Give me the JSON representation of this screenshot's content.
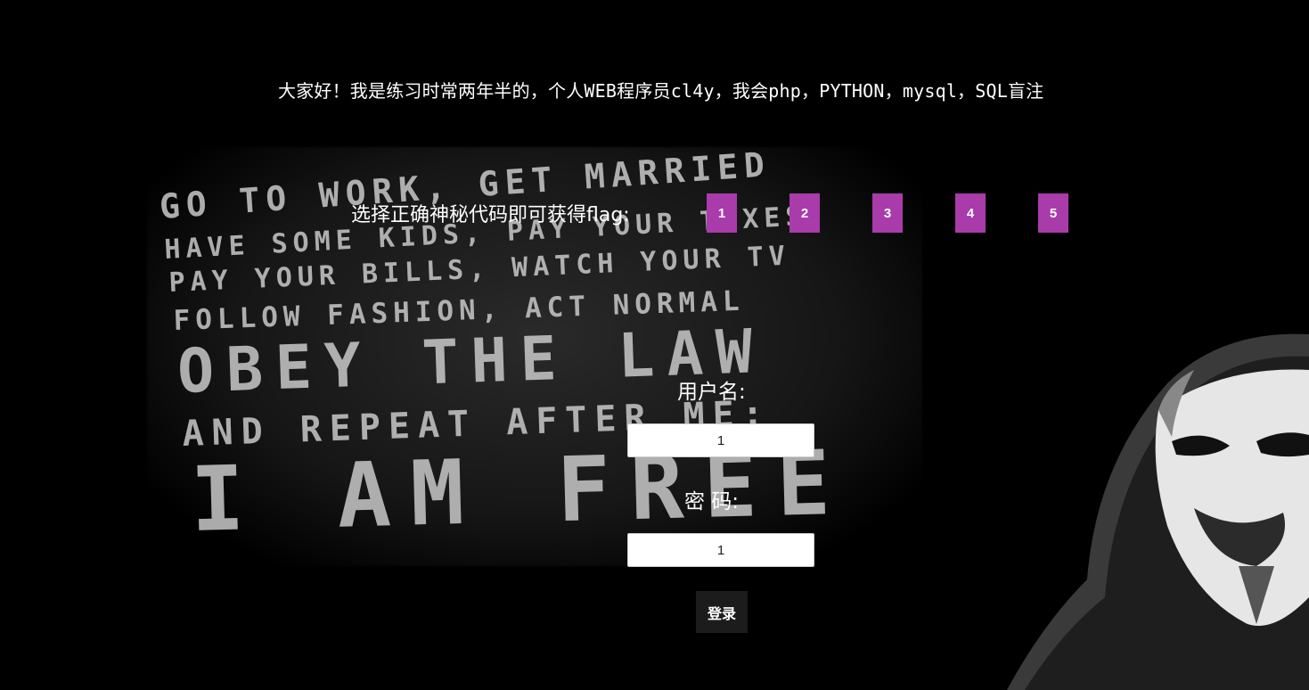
{
  "header": {
    "greeting": "大家好！我是练习时常两年半的，个人WEB程序员cl4y，我会php，PYTHON，mysql，SQL盲注"
  },
  "poster": {
    "lines": [
      "GO TO WORK, GET MARRIED",
      "HAVE SOME KIDS, PAY YOUR TAXES",
      "PAY YOUR BILLS, WATCH YOUR TV",
      "FOLLOW FASHION, ACT NORMAL",
      "OBEY THE LAW",
      "AND REPEAT AFTER ME:",
      "I AM FREE"
    ]
  },
  "code_picker": {
    "label": "选择正确神秘代码即可获得flag:",
    "options": [
      "1",
      "2",
      "3",
      "4",
      "5"
    ],
    "accent": "#a93bab"
  },
  "login_form": {
    "username_label": "用户名:",
    "username_value": "1",
    "password_label": "密 码:",
    "password_value": "1",
    "submit_label": "登录"
  }
}
